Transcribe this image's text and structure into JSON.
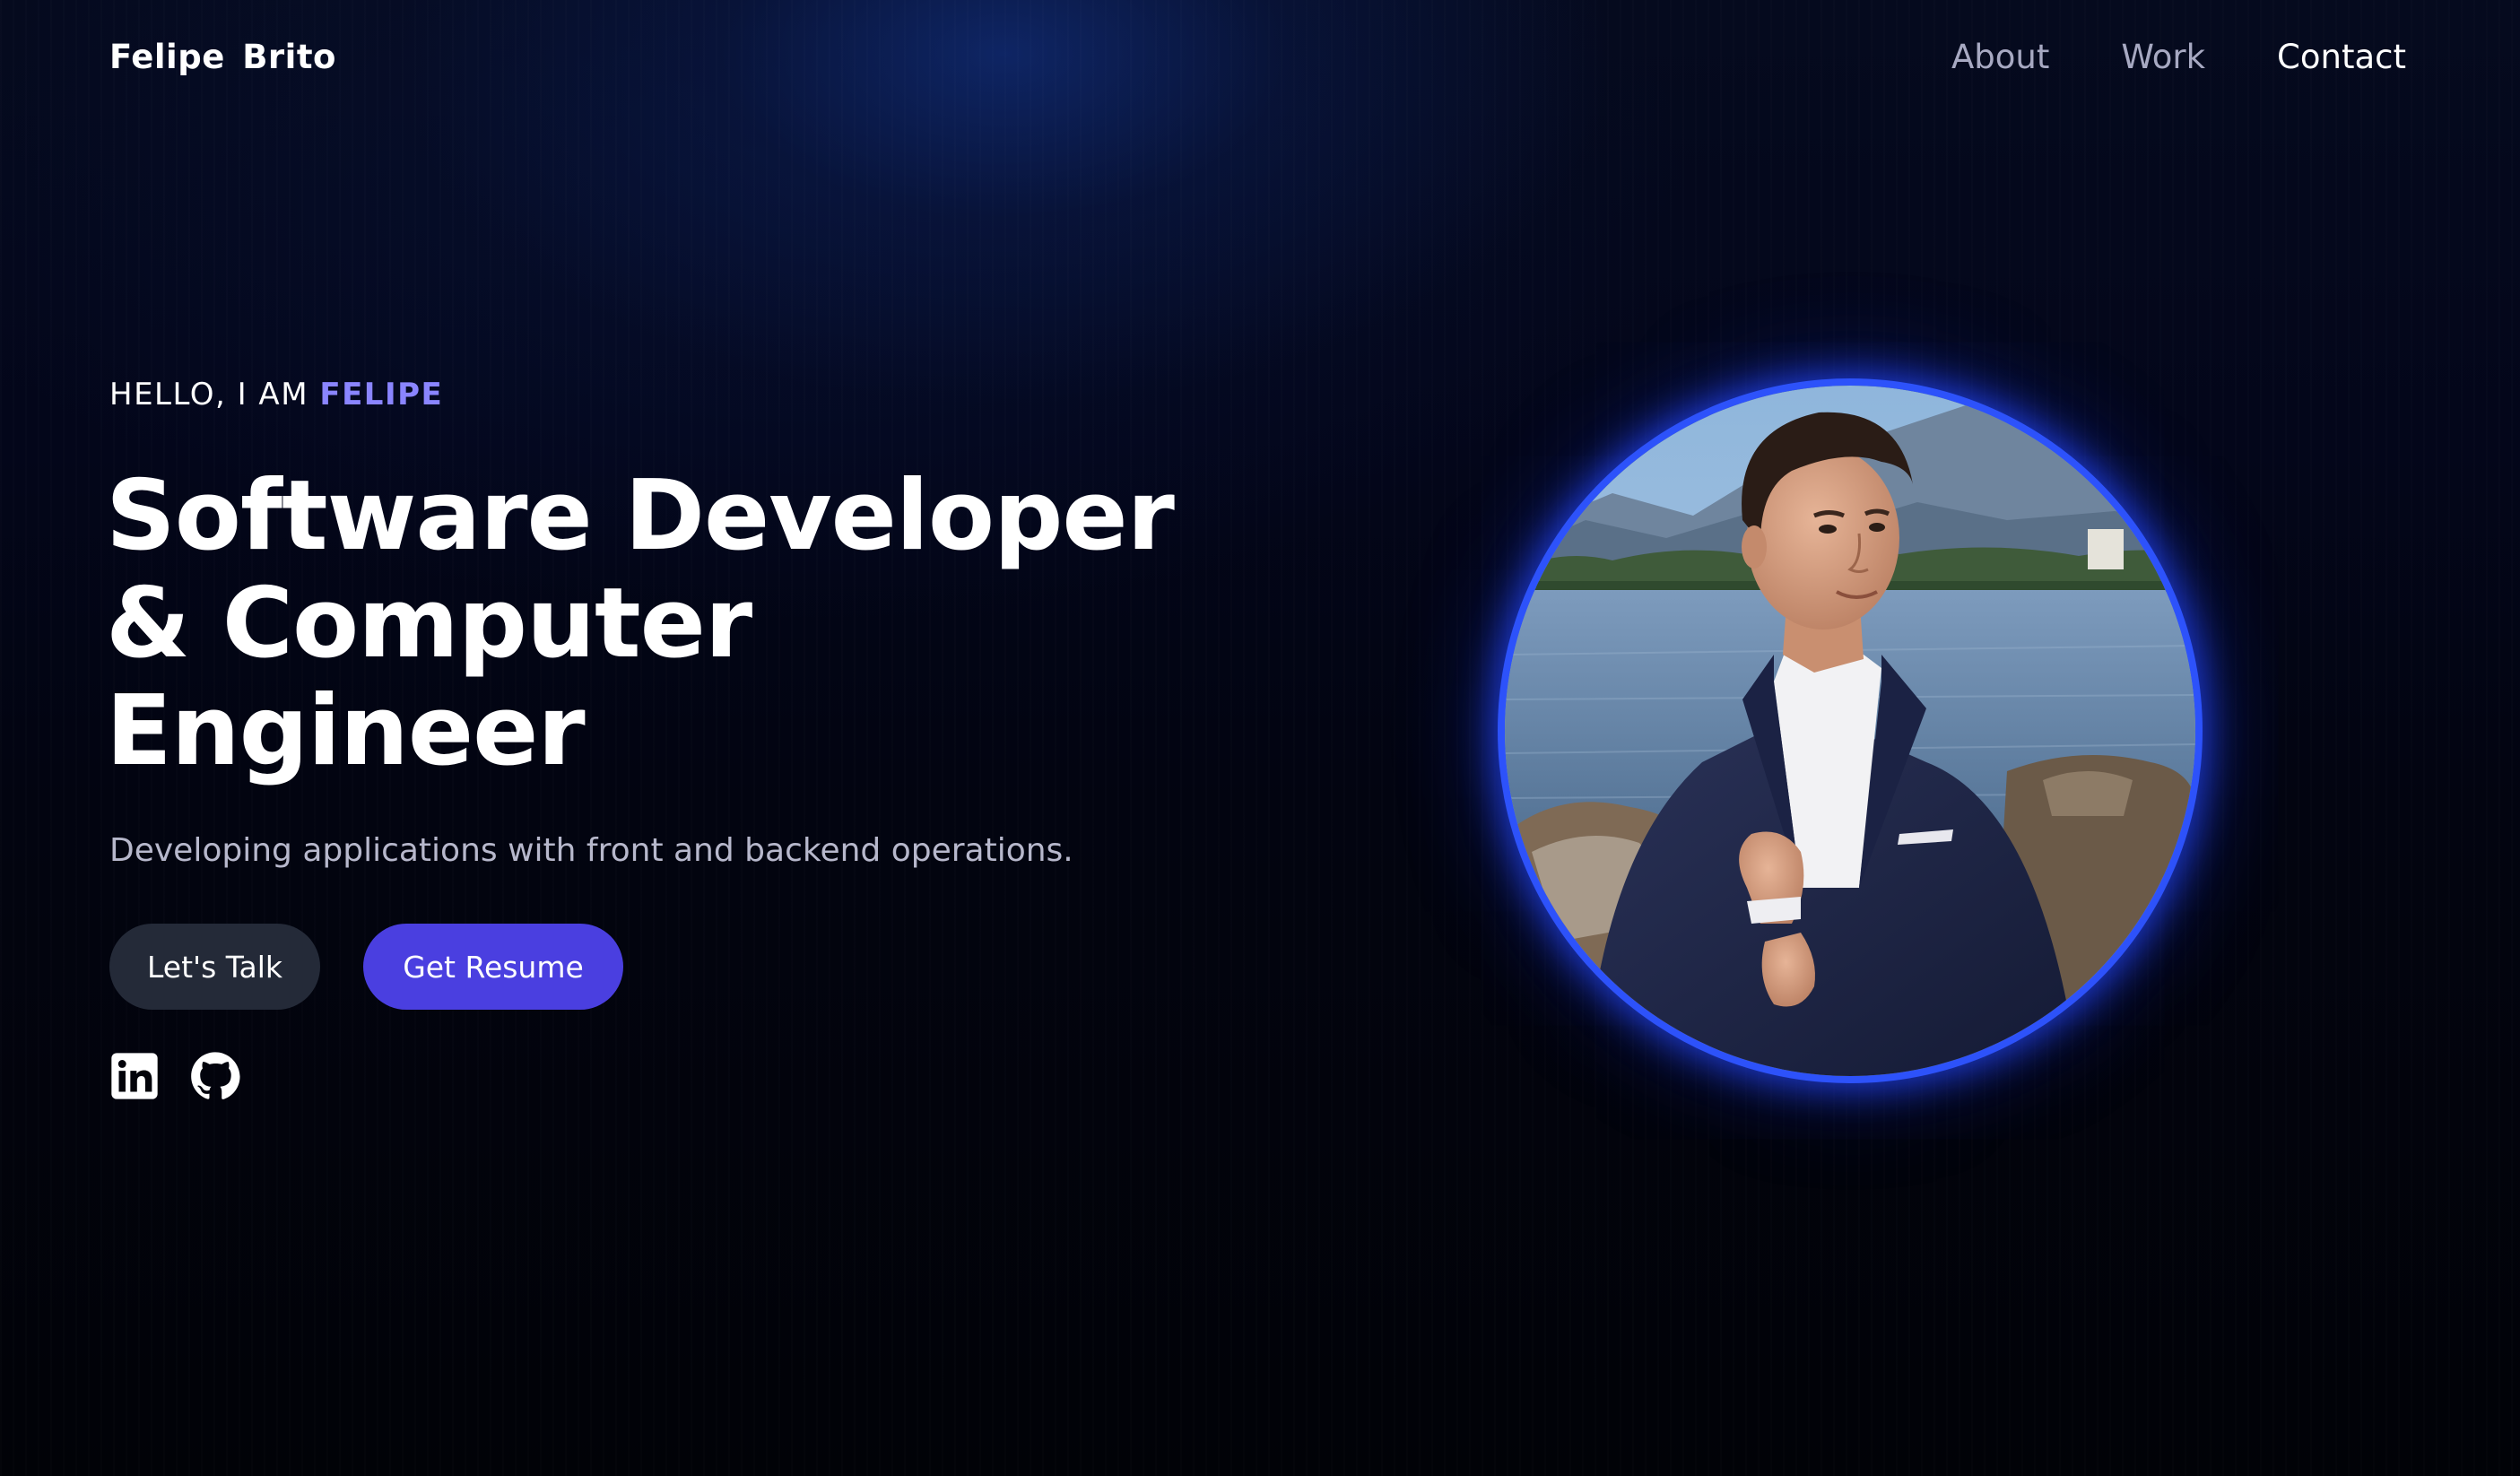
{
  "header": {
    "brand": "Felipe  Brito",
    "nav": [
      {
        "label": "About"
      },
      {
        "label": "Work"
      },
      {
        "label": "Contact"
      }
    ]
  },
  "hero": {
    "greeting_prefix": "HELLO, I AM ",
    "greeting_name": "FELIPE",
    "headline_lines": [
      "Software Developer",
      "& Computer",
      "Engineer"
    ],
    "subtitle": "Developing applications with front and backend operations.",
    "buttons": {
      "talk": "Let's Talk",
      "resume": "Get Resume"
    },
    "socials": [
      {
        "icon": "linkedin-icon"
      },
      {
        "icon": "github-icon"
      }
    ]
  },
  "colors": {
    "accent": "#4a3fe0",
    "accent_text": "#8a85ff",
    "secondary_button": "#242a38",
    "glow": "#2e54ff"
  }
}
